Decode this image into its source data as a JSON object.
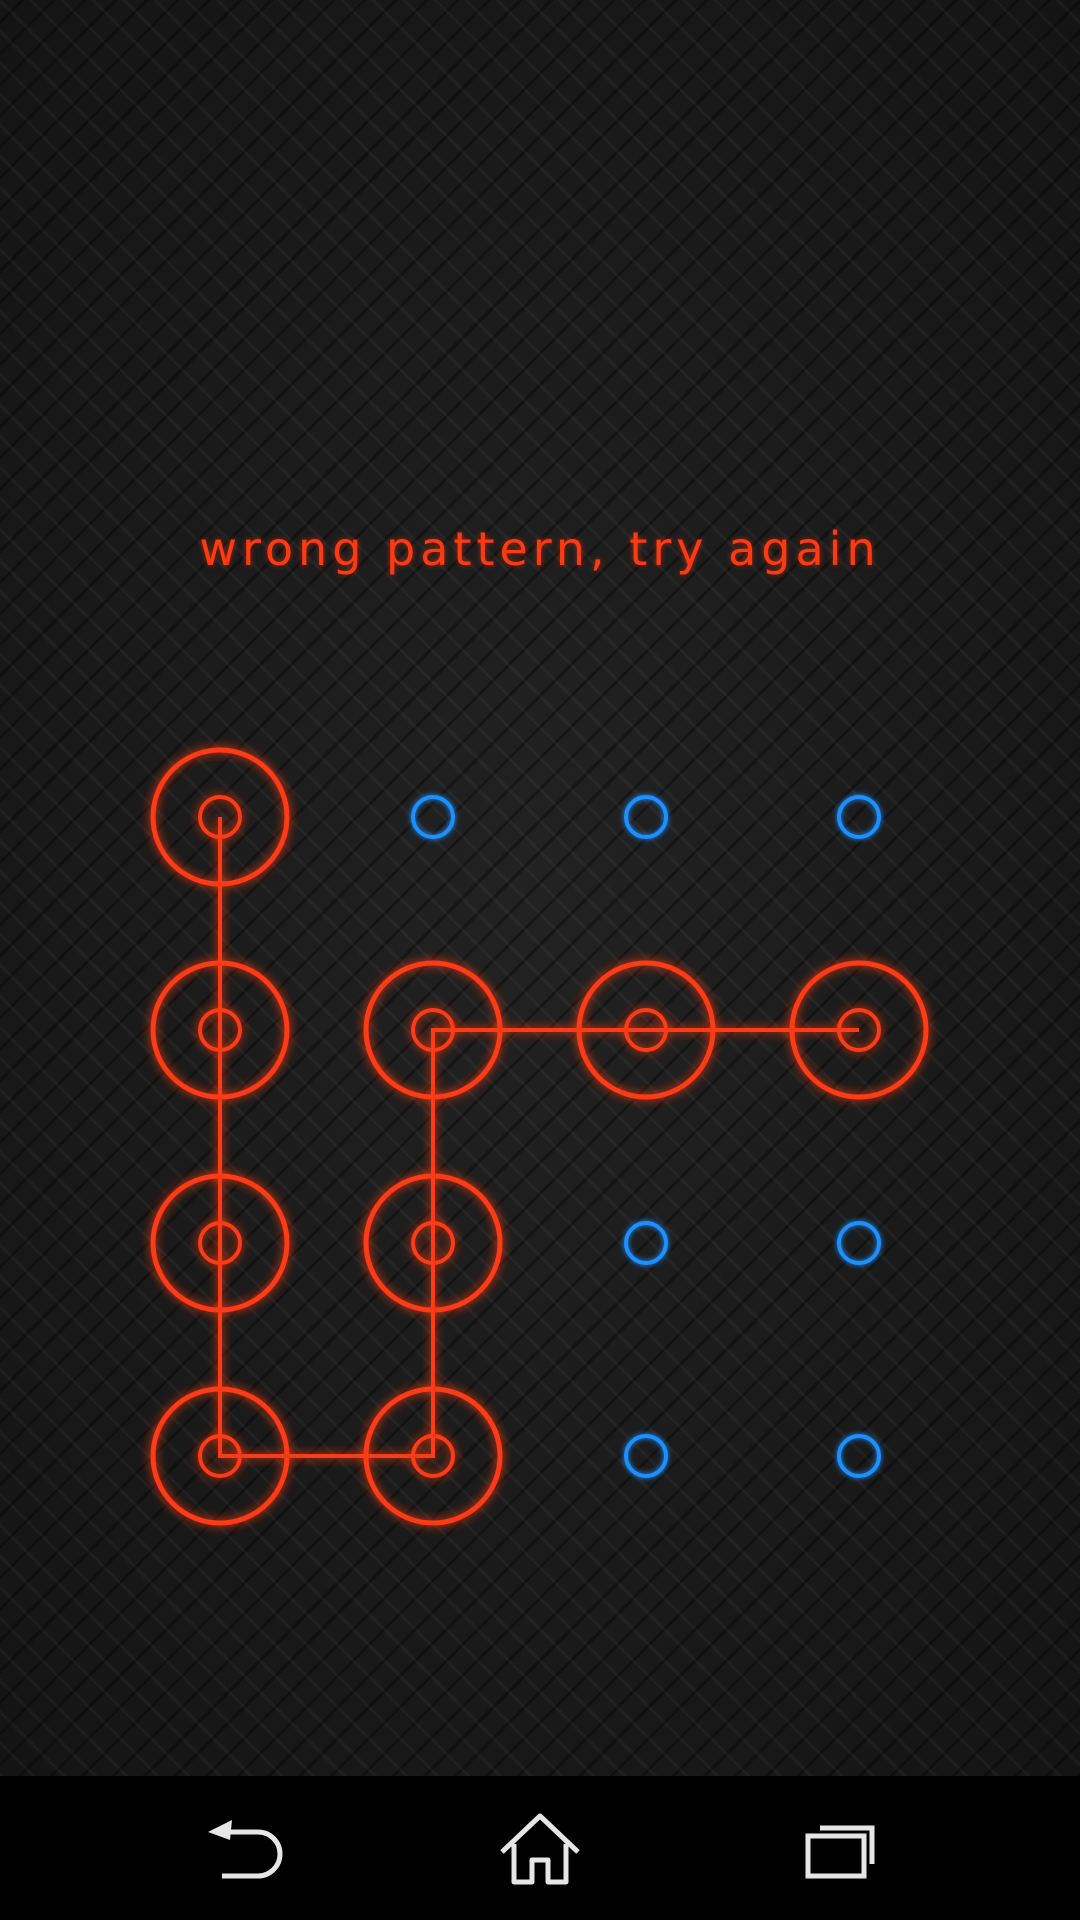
{
  "status": {
    "message": "wrong pattern, try again"
  },
  "pattern": {
    "rows": 4,
    "cols": 4,
    "selected": [
      [
        0,
        0
      ],
      [
        1,
        0
      ],
      [
        2,
        0
      ],
      [
        3,
        0
      ],
      [
        3,
        1
      ],
      [
        2,
        1
      ],
      [
        1,
        1
      ],
      [
        1,
        2
      ],
      [
        1,
        3
      ]
    ]
  },
  "colors": {
    "error": "#ff3a12",
    "idle": "#1e90ff",
    "background": "#1b1b1b",
    "nav_background": "#000000",
    "nav_icon": "#e6e6e6"
  },
  "nav": {
    "buttons": [
      {
        "icon": "back-icon"
      },
      {
        "icon": "home-icon"
      },
      {
        "icon": "recent-apps-icon"
      }
    ]
  }
}
